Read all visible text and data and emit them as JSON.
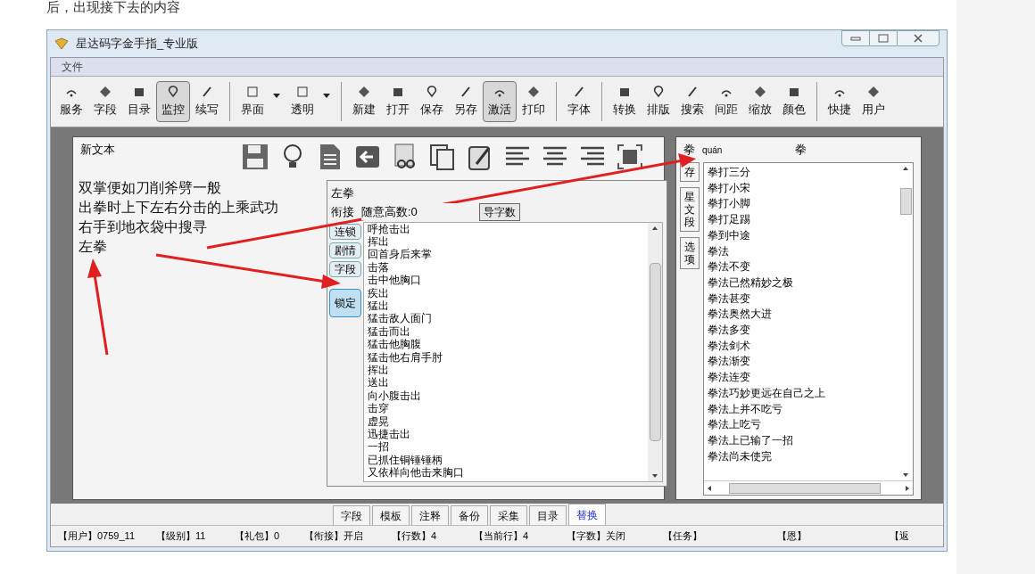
{
  "article_text": "后，出现接下去的内容",
  "window": {
    "title": "星达码字金手指_专业版"
  },
  "menu": [
    "文件"
  ],
  "toolbar": [
    [
      {
        "label": "服务",
        "kind": "button",
        "selected": false
      },
      {
        "label": "字段",
        "kind": "button",
        "selected": false
      },
      {
        "label": "目录",
        "kind": "button",
        "selected": false
      },
      {
        "label": "监控",
        "kind": "button",
        "selected": true
      },
      {
        "label": "续写",
        "kind": "button",
        "selected": false
      }
    ],
    [
      {
        "label": "界面",
        "kind": "dropdown",
        "selected": false
      },
      {
        "label": "透明",
        "kind": "dropdown",
        "selected": false
      }
    ],
    [
      {
        "label": "新建",
        "kind": "button",
        "selected": false
      },
      {
        "label": "打开",
        "kind": "button",
        "selected": false
      },
      {
        "label": "保存",
        "kind": "button",
        "selected": false
      },
      {
        "label": "另存",
        "kind": "button",
        "selected": false
      },
      {
        "label": "激活",
        "kind": "button",
        "selected": true
      },
      {
        "label": "打印",
        "kind": "button",
        "selected": false
      }
    ],
    [
      {
        "label": "字体",
        "kind": "button",
        "selected": false
      }
    ],
    [
      {
        "label": "转换",
        "kind": "button",
        "selected": false
      },
      {
        "label": "排版",
        "kind": "button",
        "selected": false
      },
      {
        "label": "搜索",
        "kind": "button",
        "selected": false
      },
      {
        "label": "间距",
        "kind": "button",
        "selected": false
      },
      {
        "label": "缩放",
        "kind": "button",
        "selected": false
      },
      {
        "label": "颜色",
        "kind": "button",
        "selected": false
      }
    ],
    [
      {
        "label": "快捷",
        "kind": "button",
        "selected": false
      },
      {
        "label": "用户",
        "kind": "button",
        "selected": false
      }
    ]
  ],
  "editor": {
    "title": "新文本",
    "lines": [
      "双掌便如刀削斧劈一般",
      "出拳时上下左右分击的上乘武功",
      "右手到地衣袋中搜寻",
      "左拳"
    ]
  },
  "popup": {
    "word": "左拳",
    "link_label": "衔接",
    "link_value": "随意高数:0",
    "button": "导字数",
    "side_buttons": [
      {
        "label": "连锁",
        "selected": false
      },
      {
        "label": "剧情",
        "selected": false
      },
      {
        "label": "字段",
        "selected": false
      },
      {
        "label": "锁定",
        "selected": true
      }
    ],
    "items": [
      "呼抢击出",
      "挥出",
      "回首身后来掌",
      "击落",
      "击中他胸口",
      "疾出",
      "猛出",
      "猛击敌人面门",
      "猛击而出",
      "猛击他胸腹",
      "猛击他右肩手肘",
      "挥出",
      "送出",
      "向小腹击出",
      "击穿",
      "虚晃",
      "迅捷击出",
      "一招",
      "已抓住铜锤锤柄",
      "又依样向他击来胸口"
    ]
  },
  "dictionary": {
    "char": "拳",
    "pinyin": "quán",
    "char_repeat": "拳",
    "side_tabs": [
      "存",
      "星文段",
      "选项"
    ],
    "items": [
      "拳打三分",
      "拳打小宋",
      "拳打小脚",
      "拳打足踢",
      "拳到中途",
      "拳法",
      "拳法不变",
      "拳法已然精妙之极",
      "拳法甚变",
      "拳法奥然大进",
      "拳法多变",
      "拳法剑术",
      "拳法渐变",
      "拳法连变",
      "拳法巧妙更远在自己之上",
      "拳法上并不吃亏",
      "拳法上吃亏",
      "拳法上已输了一招",
      "拳法尚未使完"
    ]
  },
  "bottom_tabs": [
    {
      "label": "字段",
      "selected": false
    },
    {
      "label": "模板",
      "selected": false
    },
    {
      "label": "注释",
      "selected": false
    },
    {
      "label": "备份",
      "selected": false
    },
    {
      "label": "采集",
      "selected": false
    },
    {
      "label": "目录",
      "selected": false
    },
    {
      "label": "替换",
      "selected": true
    }
  ],
  "status_bar": [
    {
      "label": "【用户】",
      "value": "0759_11"
    },
    {
      "label": "【级别】",
      "value": "11"
    },
    {
      "label": "【礼包】",
      "value": "0"
    },
    {
      "label": "【衔接】",
      "value": "开启"
    },
    {
      "label": "【行数】",
      "value": "4"
    },
    {
      "label": "【当前行】",
      "value": "4"
    },
    {
      "label": "【字数】",
      "value": "关闭"
    },
    {
      "label": "【任务】"
    },
    {
      "label": "【恩】"
    },
    {
      "label": "【返"
    }
  ]
}
